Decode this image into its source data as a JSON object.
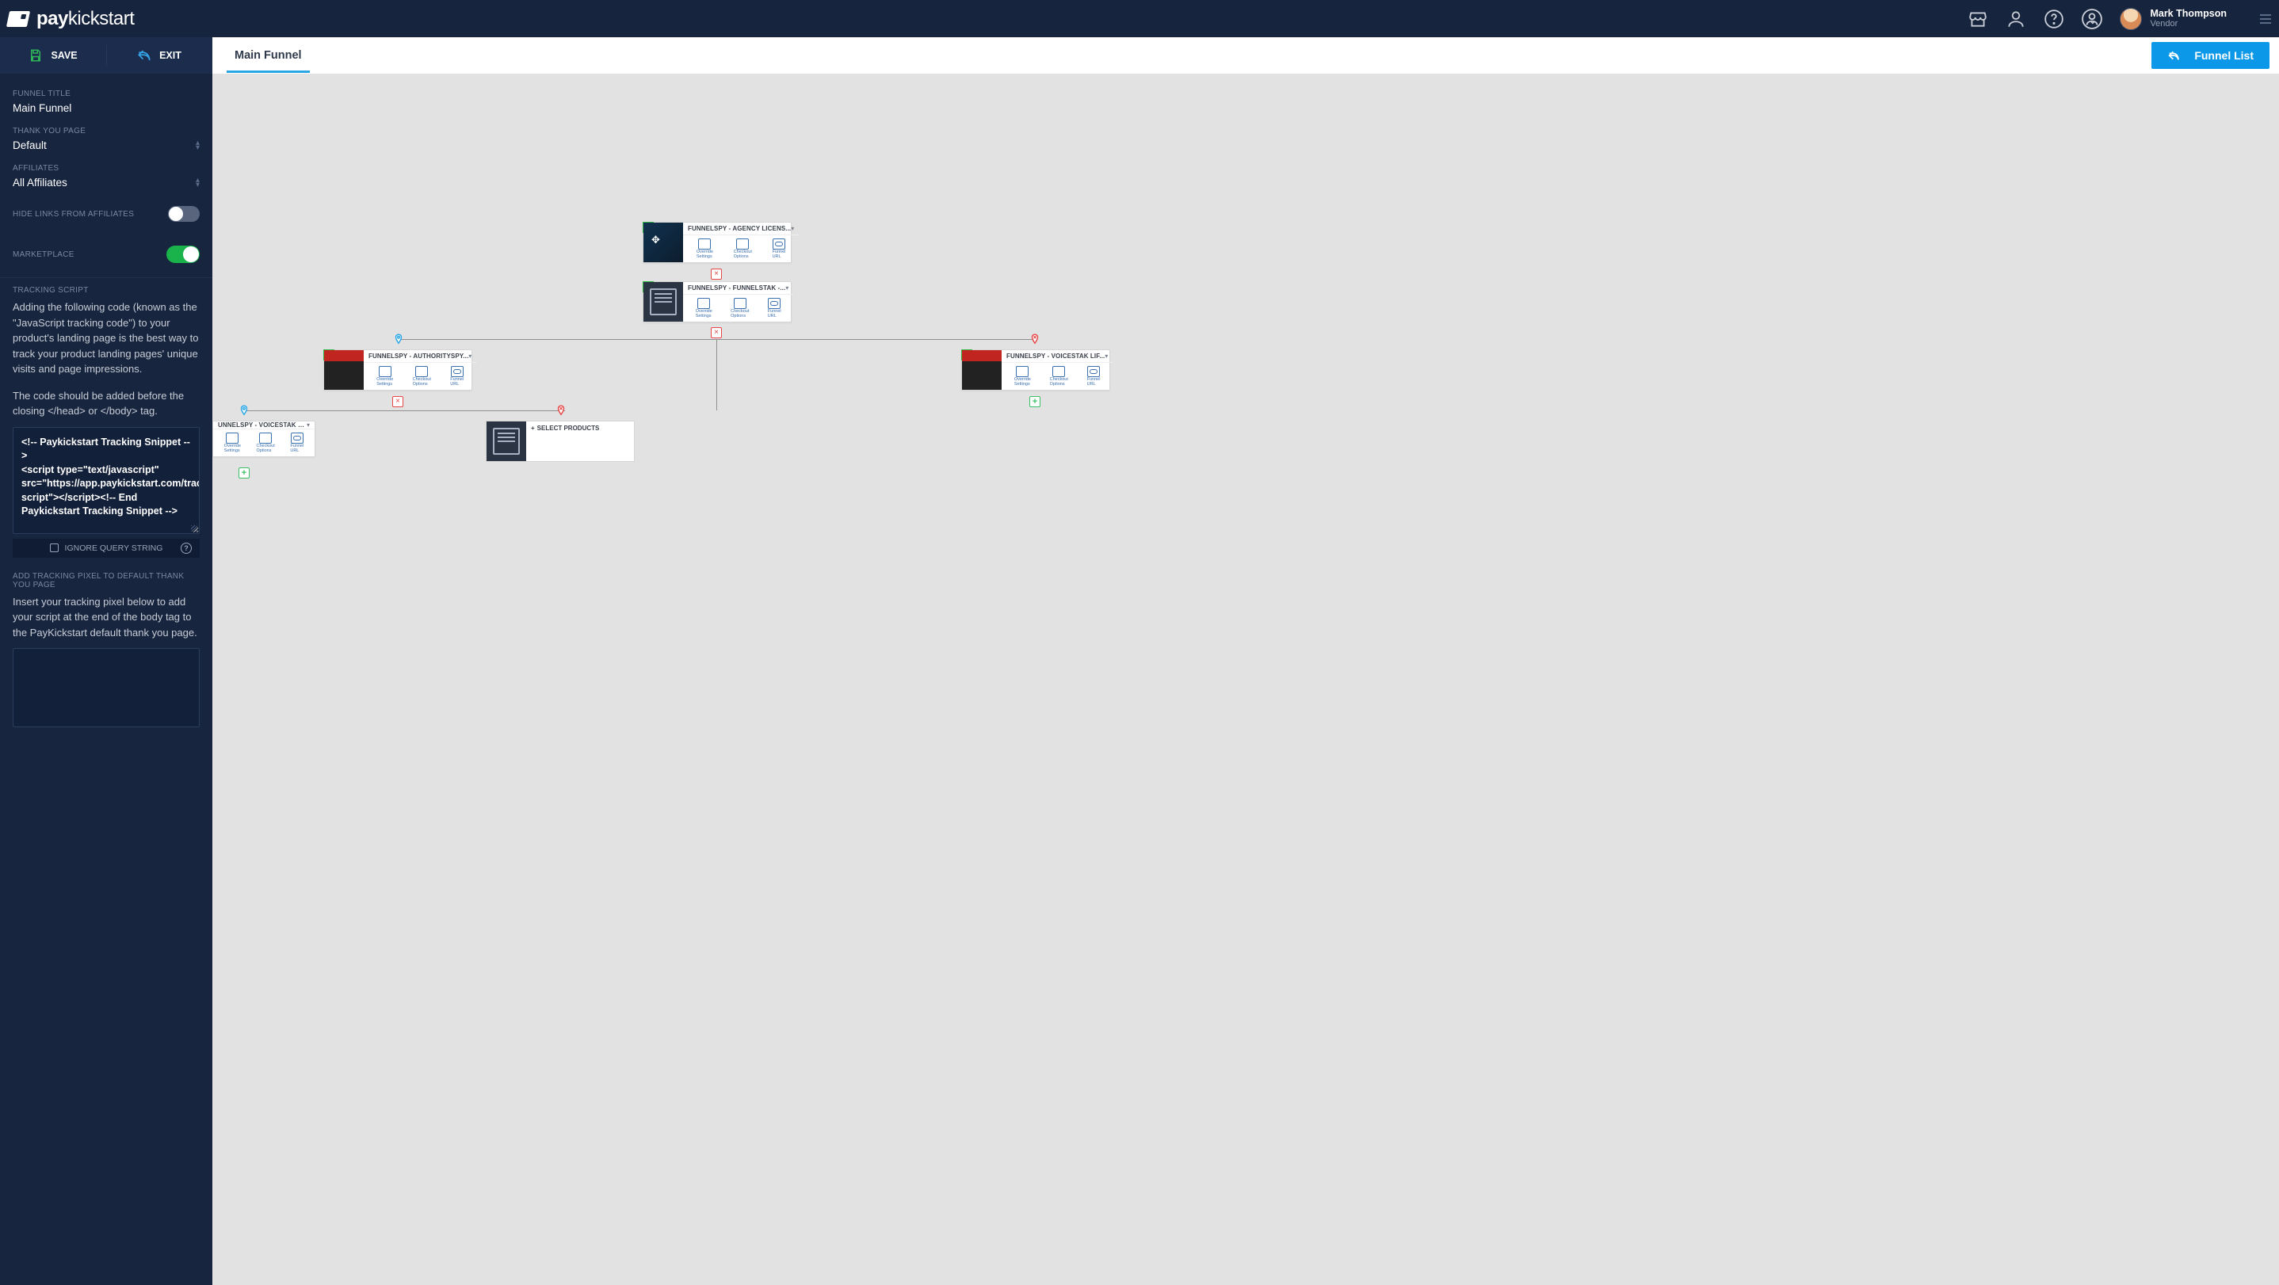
{
  "brand": {
    "pre": "pay",
    "post": "kickstart"
  },
  "user": {
    "name": "Mark Thompson",
    "role": "Vendor"
  },
  "sideActions": {
    "save": "SAVE",
    "exit": "EXIT"
  },
  "sidebar": {
    "funnelTitle": {
      "label": "FUNNEL TITLE",
      "value": "Main Funnel"
    },
    "thankYou": {
      "label": "THANK YOU PAGE",
      "value": "Default"
    },
    "affiliates": {
      "label": "AFFILIATES",
      "value": "All Affiliates"
    },
    "hideLinks": {
      "label": "HIDE LINKS FROM AFFILIATES"
    },
    "marketplace": {
      "label": "MARKETPLACE"
    },
    "tracking": {
      "label": "TRACKING SCRIPT",
      "desc1": "Adding the following code (known as the \"JavaScript tracking code\") to your product's landing page is the best way to track your product landing pages' unique visits and page impressions.",
      "desc2": "The code should be added before the closing </head> or </body> tag.",
      "code": "<!-- Paykickstart Tracking Snippet -->\n<script type=\"text/javascript\" src=\"https://app.paykickstart.com/tracking-script\"></script><!-- End Paykickstart Tracking Snippet -->",
      "ignore": "IGNORE QUERY STRING"
    },
    "pixel": {
      "label": "ADD TRACKING PIXEL TO DEFAULT THANK YOU PAGE",
      "desc": "Insert your tracking pixel below to add your script at the end of the body tag to the PayKickstart default thank you page."
    }
  },
  "tools": {
    "override": "Override\nSettings",
    "checkout": "Checkout\nOptions",
    "funnelUrl": "Funnel\nURL"
  },
  "canvas": {
    "title": "Main Funnel",
    "backLabel": "Funnel List"
  },
  "cards": {
    "agency": {
      "title": "FUNNELSPY - AGENCY LICENS..."
    },
    "funnelstak": {
      "title": "FUNNELSPY - FUNNELSTAK -..."
    },
    "authority": {
      "title": "FUNNELSPY - AUTHORITYSPY..."
    },
    "voicestakLif": {
      "title": "FUNNELSPY - VOICESTAK LIF..."
    },
    "voicestakLif2": {
      "title": "UNNELSPY - VOICESTAK LIF..."
    },
    "placeholder": {
      "plus": "+",
      "text": "SELECT PRODUCTS"
    }
  }
}
